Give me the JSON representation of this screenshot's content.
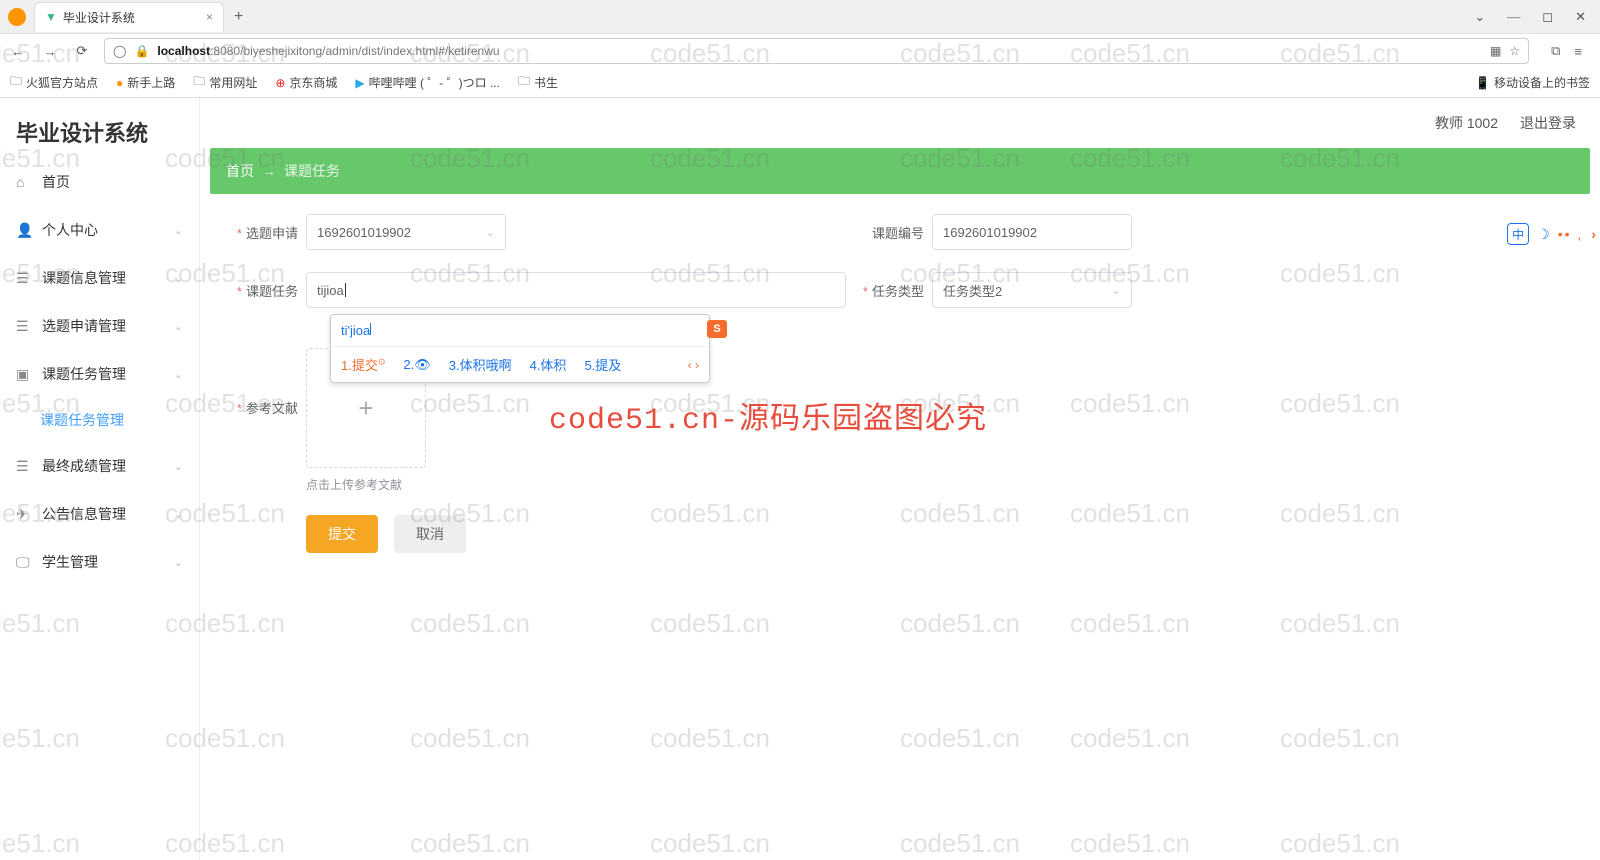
{
  "browser": {
    "tab_title": "毕业设计系统",
    "url_host": "localhost",
    "url_path": ":8080/biyeshejixitong/admin/dist/index.html#/ketirenwu",
    "bookmarks": [
      "火狐官方站点",
      "新手上路",
      "常用网址",
      "京东商城",
      "哔哩哔哩 ( ゜- ゜)つロ ...",
      "书生"
    ],
    "mobile_bookmark": "移动设备上的书签"
  },
  "app": {
    "title": "毕业设计系统",
    "topbar": {
      "user": "教师 1002",
      "logout": "退出登录"
    },
    "sidebar": {
      "items": [
        {
          "icon": "home",
          "label": "首页"
        },
        {
          "icon": "user",
          "label": "个人中心",
          "expand": true
        },
        {
          "icon": "list",
          "label": "课题信息管理",
          "expand": true
        },
        {
          "icon": "list",
          "label": "选题申请管理",
          "expand": true
        },
        {
          "icon": "list",
          "label": "课题任务管理",
          "expand": true
        },
        {
          "icon": "list",
          "label": "最终成绩管理",
          "expand": true
        },
        {
          "icon": "send",
          "label": "公告信息管理",
          "expand": true
        },
        {
          "icon": "monitor",
          "label": "学生管理",
          "expand": true
        }
      ],
      "submenu_active": "课题任务管理"
    },
    "breadcrumb": {
      "home": "首页",
      "arrow": "→",
      "current": "课题任务"
    },
    "form": {
      "topic_apply_label": "选题申请",
      "topic_apply_value": "1692601019902",
      "topic_no_label": "课题编号",
      "topic_no_value": "1692601019902",
      "task_label": "课题任务",
      "task_value": "tijioa",
      "task_type_label": "任务类型",
      "task_type_value": "任务类型2",
      "ref_label": "参考文献",
      "upload_plus": "+",
      "upload_tip": "点击上传参考文献",
      "submit": "提交",
      "cancel": "取消"
    }
  },
  "ime": {
    "composition": "ti'jioa",
    "candidates": [
      "1.提交",
      "2.",
      "3.体积哦啊",
      "4.体积",
      "5.提及"
    ],
    "logo": "S",
    "zh": "中"
  },
  "watermark": {
    "text": "code51.cn",
    "center": "code51.cn-源码乐园盗图必究"
  }
}
